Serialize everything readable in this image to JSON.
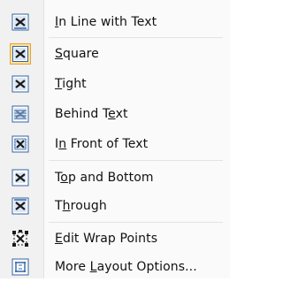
{
  "menu": {
    "items": [
      {
        "label": "In Line with Text",
        "mnemonic_index": 0,
        "icon": "inline-wrap-icon",
        "checked": false
      },
      {
        "label": "Square",
        "mnemonic_index": 0,
        "icon": "square-wrap-icon",
        "checked": true
      },
      {
        "label": "Tight",
        "mnemonic_index": 0,
        "icon": "tight-wrap-icon",
        "checked": false
      },
      {
        "label": "Behind Text",
        "mnemonic_index": 8,
        "icon": "behind-text-icon",
        "checked": false
      },
      {
        "label": "In Front of Text",
        "mnemonic_index": 1,
        "icon": "in-front-text-icon",
        "checked": false
      },
      {
        "label": "Top and Bottom",
        "mnemonic_index": 1,
        "icon": "top-bottom-wrap-icon",
        "checked": false
      },
      {
        "label": "Through",
        "mnemonic_index": 1,
        "icon": "through-wrap-icon",
        "checked": false
      },
      {
        "label": "Edit Wrap Points",
        "mnemonic_index": 0,
        "icon": "edit-wrap-points-icon",
        "checked": false
      },
      {
        "label": "More Layout Options...",
        "mnemonic_index": 5,
        "icon": "layout-options-icon",
        "checked": false
      }
    ]
  },
  "colors": {
    "checked_bg": "#fde29b",
    "checked_border": "#e8a23a",
    "icon_blue": "#3465a4",
    "icon_dark": "#1a1a1a"
  }
}
